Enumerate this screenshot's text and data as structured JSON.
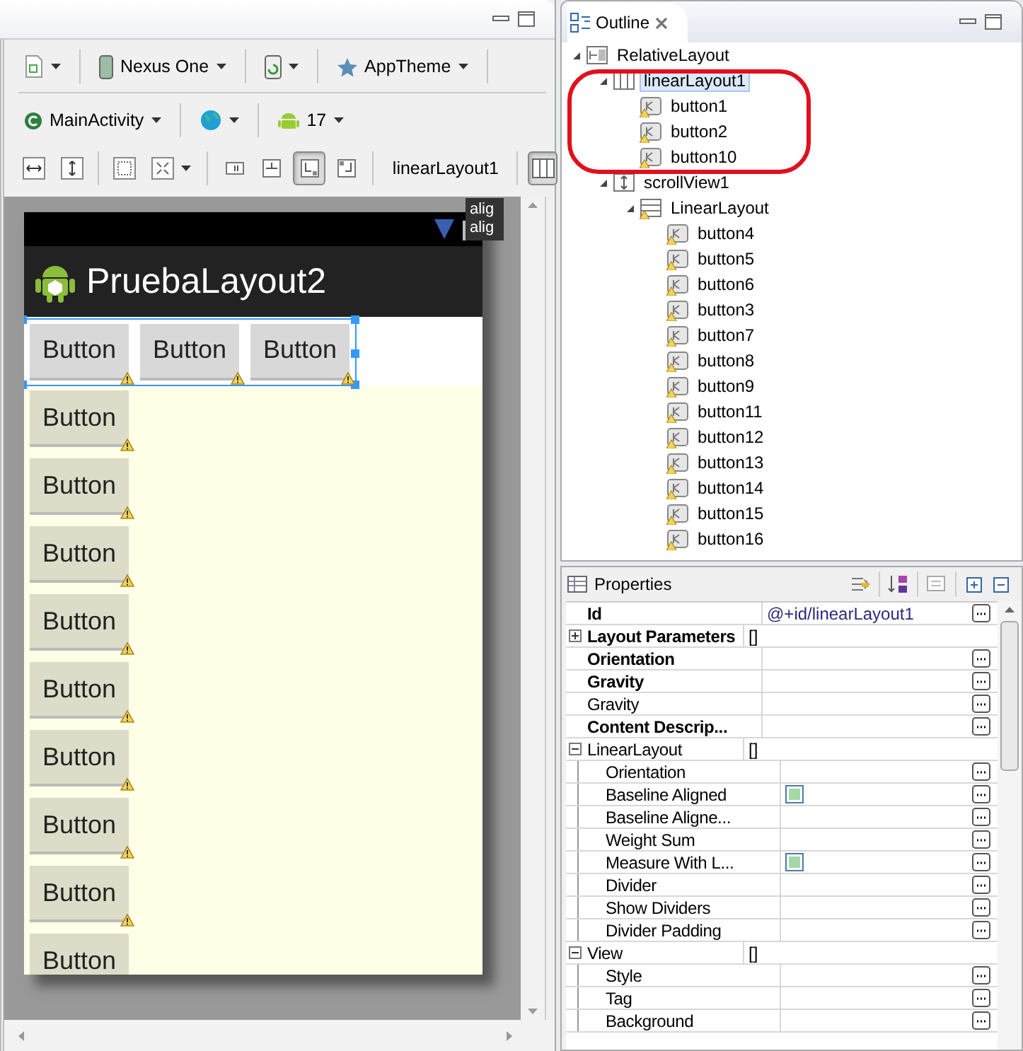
{
  "toolbar": {
    "device": "Nexus One",
    "theme": "AppTheme",
    "activity": "MainActivity",
    "api_level": "17",
    "layout_actions": [
      {
        "pressed": false
      },
      {
        "pressed": false
      },
      {
        "pressed": true
      },
      {
        "pressed": false
      }
    ],
    "selection_label": "linearLayout1",
    "view_toggle": {
      "pressed": true
    }
  },
  "preview": {
    "app_title": "PruebaLayout2",
    "top_buttons": [
      {
        "label": "Button",
        "warning": true
      },
      {
        "label": "Button",
        "warning": true
      },
      {
        "label": "Button",
        "warning": true
      }
    ],
    "scroll_buttons": [
      {
        "label": "Button",
        "warning": true
      },
      {
        "label": "Button",
        "warning": true
      },
      {
        "label": "Button",
        "warning": true
      },
      {
        "label": "Button",
        "warning": true
      },
      {
        "label": "Button",
        "warning": true
      },
      {
        "label": "Button",
        "warning": true
      },
      {
        "label": "Button",
        "warning": true
      },
      {
        "label": "Button",
        "warning": true
      },
      {
        "label": "Button",
        "warning": false
      }
    ],
    "tooltip_lines": [
      "alig",
      "alig"
    ]
  },
  "outline": {
    "title": "Outline",
    "tree": [
      {
        "label": "RelativeLayout",
        "kind": "relative",
        "selected": false,
        "warning": false,
        "expanded": true,
        "children": [
          {
            "label": "linearLayout1",
            "kind": "horizontal",
            "selected": true,
            "warning": false,
            "expanded": true,
            "children": [
              {
                "label": "button1",
                "kind": "button",
                "selected": false,
                "warning": true
              },
              {
                "label": "button2",
                "kind": "button",
                "selected": false,
                "warning": true
              },
              {
                "label": "button10",
                "kind": "button",
                "selected": false,
                "warning": true
              }
            ]
          },
          {
            "label": "scrollView1",
            "kind": "scroll",
            "selected": false,
            "warning": false,
            "expanded": true,
            "children": [
              {
                "label": "LinearLayout",
                "kind": "vertical",
                "selected": false,
                "warning": true,
                "expanded": true,
                "children": [
                  {
                    "label": "button4",
                    "kind": "button",
                    "selected": false,
                    "warning": true
                  },
                  {
                    "label": "button5",
                    "kind": "button",
                    "selected": false,
                    "warning": true
                  },
                  {
                    "label": "button6",
                    "kind": "button",
                    "selected": false,
                    "warning": true
                  },
                  {
                    "label": "button3",
                    "kind": "button",
                    "selected": false,
                    "warning": true
                  },
                  {
                    "label": "button7",
                    "kind": "button",
                    "selected": false,
                    "warning": true
                  },
                  {
                    "label": "button8",
                    "kind": "button",
                    "selected": false,
                    "warning": true
                  },
                  {
                    "label": "button9",
                    "kind": "button",
                    "selected": false,
                    "warning": true
                  },
                  {
                    "label": "button11",
                    "kind": "button",
                    "selected": false,
                    "warning": true
                  },
                  {
                    "label": "button12",
                    "kind": "button",
                    "selected": false,
                    "warning": true
                  },
                  {
                    "label": "button13",
                    "kind": "button",
                    "selected": false,
                    "warning": true
                  },
                  {
                    "label": "button14",
                    "kind": "button",
                    "selected": false,
                    "warning": true
                  },
                  {
                    "label": "button15",
                    "kind": "button",
                    "selected": false,
                    "warning": true
                  },
                  {
                    "label": "button16",
                    "kind": "button",
                    "selected": false,
                    "warning": true
                  }
                ]
              }
            ]
          }
        ]
      }
    ]
  },
  "properties": {
    "title": "Properties",
    "rows": [
      {
        "kind": "property",
        "name": "Id",
        "value": "@+id/linearLayout1",
        "bold": true
      },
      {
        "kind": "category",
        "name": "Layout Parameters",
        "value": "[]",
        "bold": true,
        "expanded": false
      },
      {
        "kind": "property",
        "name": "Orientation",
        "bold": true
      },
      {
        "kind": "property",
        "name": "Gravity",
        "bold": true
      },
      {
        "kind": "property",
        "name": "Gravity",
        "bold": false
      },
      {
        "kind": "property",
        "name": "Content Descrip...",
        "bold": true
      },
      {
        "kind": "category",
        "name": "LinearLayout",
        "value": "[]",
        "bold": false,
        "expanded": true,
        "children": [
          {
            "kind": "property",
            "name": "Orientation",
            "bold": false
          },
          {
            "kind": "checkbox",
            "name": "Baseline Aligned",
            "bold": false,
            "checked": false
          },
          {
            "kind": "property",
            "name": "Baseline Aligne...",
            "bold": false
          },
          {
            "kind": "property",
            "name": "Weight Sum",
            "bold": false
          },
          {
            "kind": "checkbox",
            "name": "Measure With L...",
            "bold": false,
            "checked": false
          },
          {
            "kind": "property",
            "name": "Divider",
            "bold": false
          },
          {
            "kind": "property",
            "name": "Show Dividers",
            "bold": false
          },
          {
            "kind": "property",
            "name": "Divider Padding",
            "bold": false
          }
        ]
      },
      {
        "kind": "category",
        "name": "View",
        "value": "[]",
        "bold": false,
        "expanded": true,
        "children": [
          {
            "kind": "property",
            "name": "Style",
            "bold": false
          },
          {
            "kind": "property",
            "name": "Tag",
            "bold": false
          },
          {
            "kind": "property",
            "name": "Background",
            "bold": false
          }
        ]
      }
    ]
  }
}
